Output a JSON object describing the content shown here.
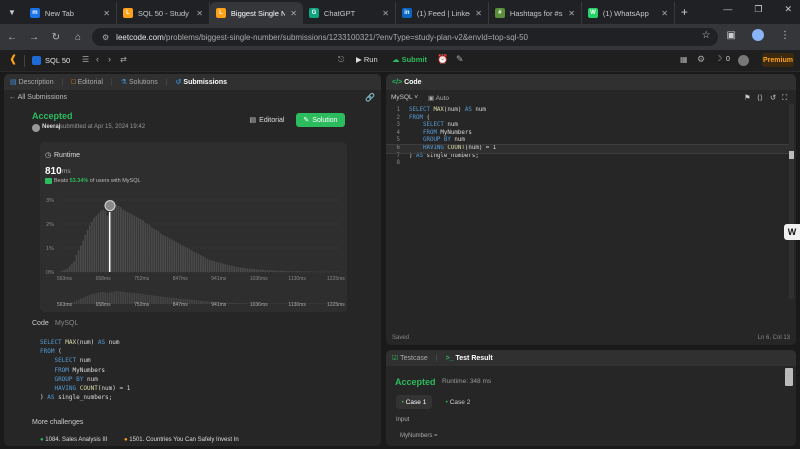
{
  "browser": {
    "tabs": [
      {
        "title": "New Tab",
        "color": "#1a73e8",
        "icon": "m"
      },
      {
        "title": "SQL 50 - Study Pl",
        "color": "#ffa116",
        "icon": "L"
      },
      {
        "title": "Biggest Single N",
        "color": "#ffa116",
        "icon": "L",
        "active": true
      },
      {
        "title": "ChatGPT",
        "color": "#10a37f",
        "icon": "G"
      },
      {
        "title": "(1) Feed | LinkedI",
        "color": "#0a66c2",
        "icon": "in"
      },
      {
        "title": "Hashtags for #s",
        "color": "#5a8f3a",
        "icon": "#"
      },
      {
        "title": "(1) WhatsApp",
        "color": "#25d366",
        "icon": "W"
      }
    ],
    "url_host": "leetcode.com",
    "url_path": "/problems/biggest-single-number/submissions/1233100321/?envType=study-plan-v2&envId=top-sql-50"
  },
  "nav": {
    "study_plan": "SQL 50",
    "run": "Run",
    "submit": "Submit",
    "streak": "0",
    "premium": "Premium"
  },
  "left_tabs": {
    "description": "Description",
    "editorial": "Editorial",
    "solutions": "Solutions",
    "submissions": "Submissions"
  },
  "submission": {
    "back": "All Submissions",
    "status": "Accepted",
    "user": "Neeraj",
    "submitted_at": "submitted at Apr 15, 2024 19:42",
    "editorial_btn": "Editorial",
    "solution_btn": "Solution",
    "runtime_label": "Runtime",
    "runtime_value": "810",
    "runtime_unit": "ms",
    "beats_prefix": "Beats",
    "beats_pct": "53.34%",
    "beats_suffix": "of users with MySQL"
  },
  "chart_data": {
    "type": "bar",
    "y_ticks": [
      "3%",
      "2%",
      "1%",
      "0%"
    ],
    "ylim": [
      0,
      3
    ],
    "x_tick_labels": [
      "563ms",
      "658ms",
      "752ms",
      "847ms",
      "941ms",
      "1036ms",
      "1130ms",
      "1225ms"
    ],
    "highlight_value_ms": 810,
    "values": [
      0.03,
      0.06,
      0.1,
      0.15,
      0.25,
      0.35,
      0.45,
      0.7,
      0.9,
      1.1,
      1.3,
      1.55,
      1.75,
      1.95,
      2.1,
      2.25,
      2.35,
      2.45,
      2.55,
      2.6,
      2.55,
      2.35,
      2.5,
      2.6,
      2.7,
      2.8,
      2.75,
      2.7,
      2.6,
      2.55,
      2.5,
      2.45,
      2.4,
      2.35,
      2.3,
      2.25,
      2.2,
      2.15,
      2.05,
      2.0,
      1.95,
      1.85,
      1.8,
      1.75,
      1.7,
      1.6,
      1.55,
      1.5,
      1.45,
      1.4,
      1.35,
      1.3,
      1.25,
      1.2,
      1.15,
      1.1,
      1.05,
      1.0,
      0.95,
      0.9,
      0.85,
      0.8,
      0.75,
      0.7,
      0.65,
      0.6,
      0.55,
      0.5,
      0.48,
      0.45,
      0.42,
      0.4,
      0.38,
      0.35,
      0.33,
      0.3,
      0.28,
      0.26,
      0.24,
      0.22,
      0.2,
      0.18,
      0.17,
      0.16,
      0.15,
      0.14,
      0.13,
      0.12,
      0.11,
      0.1,
      0.1,
      0.09,
      0.08,
      0.08,
      0.07,
      0.07,
      0.06,
      0.06,
      0.05,
      0.05,
      0.05,
      0.04,
      0.04,
      0.04,
      0.03,
      0.03,
      0.03,
      0.03,
      0.02,
      0.02,
      0.02,
      0.02,
      0.02,
      0.02,
      0.01,
      0.01,
      0.01,
      0.01,
      0.01,
      0.01,
      0.01,
      0.01,
      0.01,
      0.01,
      0.01,
      0.01
    ],
    "highlight_index": 22,
    "colors": {
      "bar": "#4a4a4a",
      "highlight": "#ffffff"
    }
  },
  "code_section": {
    "tab_code": "Code",
    "tab_lang": "MySQL",
    "lines": [
      [
        [
          "kw",
          "SELECT "
        ],
        [
          "fn",
          "MAX"
        ],
        [
          "id",
          "(num) "
        ],
        [
          "kw",
          "AS"
        ],
        [
          "id",
          " num"
        ]
      ],
      [
        [
          "kw",
          "FROM"
        ],
        [
          "id",
          " ("
        ]
      ],
      [
        [
          "id",
          "    "
        ],
        [
          "kw",
          "SELECT"
        ],
        [
          "id",
          " num"
        ]
      ],
      [
        [
          "id",
          "    "
        ],
        [
          "kw",
          "FROM"
        ],
        [
          "id",
          " MyNumbers"
        ]
      ],
      [
        [
          "id",
          "    "
        ],
        [
          "kw",
          "GROUP BY"
        ],
        [
          "id",
          " num"
        ]
      ],
      [
        [
          "id",
          "    "
        ],
        [
          "kw",
          "HAVING "
        ],
        [
          "fn",
          "COUNT"
        ],
        [
          "id",
          "(num) = 1"
        ]
      ],
      [
        [
          "id",
          ") "
        ],
        [
          "kw",
          "AS"
        ],
        [
          "id",
          " single_numbers;"
        ]
      ]
    ]
  },
  "more_challenges": {
    "heading": "More challenges",
    "items": [
      "1084. Sales Analysis III",
      "1501. Countries You Can Safely Invest In"
    ]
  },
  "editor": {
    "title": "Code",
    "lang": "MySQL",
    "mode": "Auto",
    "saved": "Saved",
    "position": "Ln 6, Col 13",
    "current_line": 6
  },
  "result": {
    "testcase_tab": "Testcase",
    "result_tab": "Test Result",
    "status": "Accepted",
    "runtime": "Runtime: 348 ms",
    "case1": "Case 1",
    "case2": "Case 2",
    "input_label": "Input",
    "input_var": "MyNumbers ="
  }
}
